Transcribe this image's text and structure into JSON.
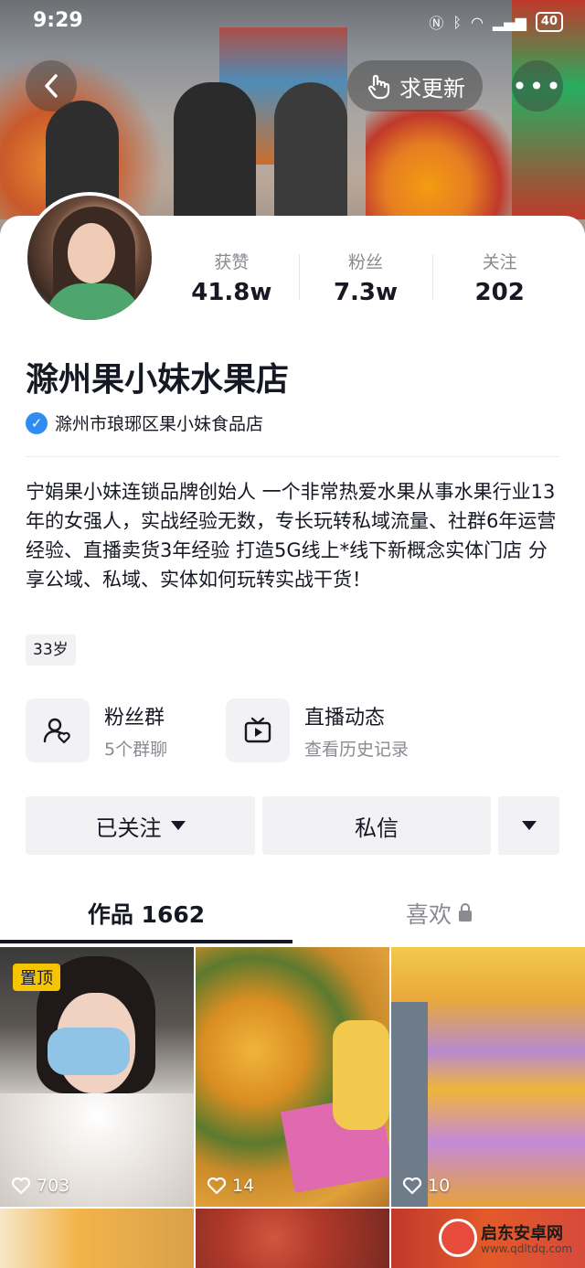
{
  "status_bar": {
    "time": "9:29",
    "battery": "40"
  },
  "header": {
    "update_label": "求更新"
  },
  "profile": {
    "stats": [
      {
        "label": "获赞",
        "value": "41.8w"
      },
      {
        "label": "粉丝",
        "value": "7.3w"
      },
      {
        "label": "关注",
        "value": "202"
      }
    ],
    "name": "滁州果小妹水果店",
    "verification": "滁州市琅琊区果小妹食品店",
    "bio": "宁娟果小妹连锁品牌创始人 一个非常热爱水果从事水果行业13年的女强人，实战经验无数，专长玩转私域流量、社群6年运营经验、直播卖货3年经验 打造5G线上*线下新概念实体门店 分享公域、私域、实体如何玩转实战干货！",
    "age_tag": "33岁"
  },
  "entries": [
    {
      "title": "粉丝群",
      "subtitle": "5个群聊"
    },
    {
      "title": "直播动态",
      "subtitle": "查看历史记录"
    }
  ],
  "actions": {
    "follow_label": "已关注",
    "message_label": "私信"
  },
  "tabs": {
    "works_label": "作品 1662",
    "likes_label": "喜欢"
  },
  "videos": [
    {
      "pinned_label": "置顶",
      "likes": "703"
    },
    {
      "likes": "14"
    },
    {
      "likes": "10"
    }
  ],
  "watermark": {
    "title": "启东安卓网",
    "url": "www.qdltdq.com"
  },
  "colors": {
    "accent": "#161823",
    "verify_blue": "#2f8cf0",
    "pin_yellow": "#f7c500"
  }
}
